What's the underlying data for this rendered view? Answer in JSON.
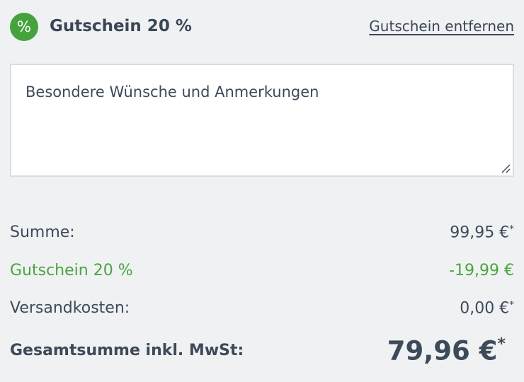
{
  "coupon": {
    "badge_icon": "percent-icon",
    "badge_symbol": "%",
    "title": "Gutschein 20 %",
    "remove_label": "Gutschein entfernen"
  },
  "notes": {
    "placeholder": "Besondere Wünsche und Anmerkungen",
    "value": ""
  },
  "summary": {
    "subtotal_label": "Summe:",
    "subtotal_value": "99,95 €",
    "subtotal_mark": "*",
    "discount_label": "Gutschein 20 %",
    "discount_value": "-19,99 €",
    "shipping_label": "Versandkosten:",
    "shipping_value": "0,00 €",
    "shipping_mark": "*",
    "total_label": "Gesamtsumme inkl. MwSt:",
    "total_value": "79,96 €",
    "total_mark": "*"
  },
  "colors": {
    "accent_green": "#44a33d",
    "text": "#3d4a59",
    "background": "#f0f1f3"
  }
}
